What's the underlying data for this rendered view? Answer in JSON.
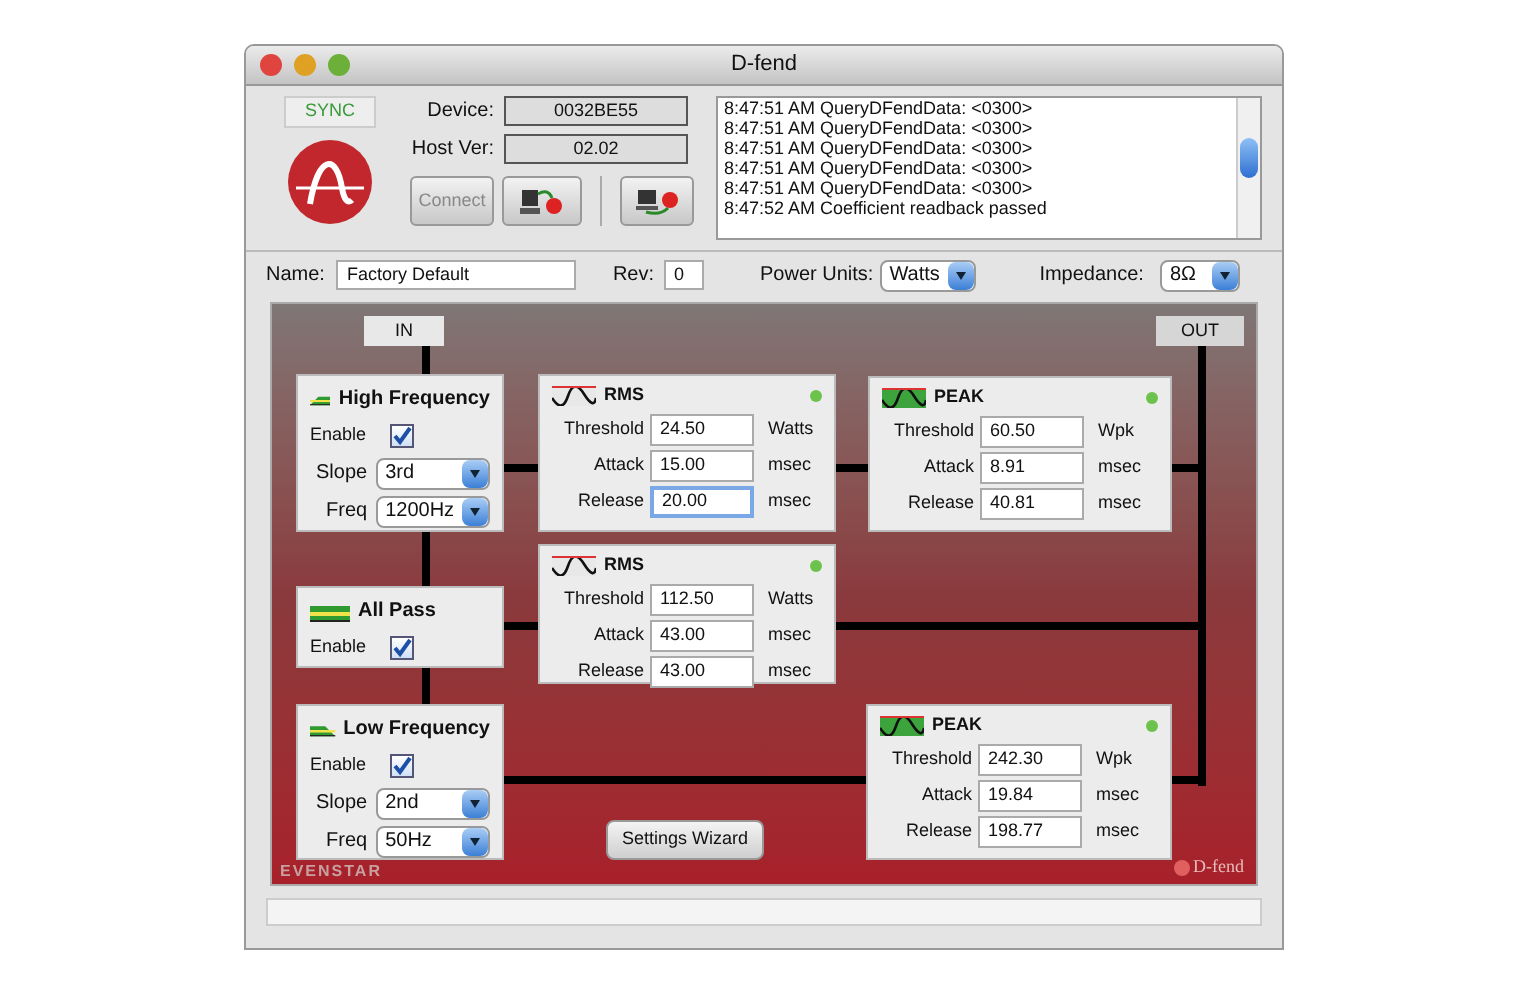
{
  "window": {
    "title": "D-fend"
  },
  "sync": {
    "label": "SYNC",
    "on": true
  },
  "device": {
    "label": "Device:",
    "value": "0032BE55"
  },
  "host_ver": {
    "label": "Host Ver:",
    "value": "02.02"
  },
  "connect_button": {
    "label": "Connect",
    "disabled": true
  },
  "log": {
    "lines": [
      "8:47:51 AM QueryDFendData: <0300>",
      "8:47:51 AM QueryDFendData: <0300>",
      "8:47:51 AM QueryDFendData: <0300>",
      "8:47:51 AM QueryDFendData: <0300>",
      "8:47:51 AM QueryDFendData: <0300>",
      "8:47:52 AM Coefficient readback passed"
    ]
  },
  "settings": {
    "name": {
      "label": "Name:",
      "value": "Factory Default"
    },
    "rev": {
      "label": "Rev:",
      "value": "0"
    },
    "power_units": {
      "label": "Power Units:",
      "value": "Watts"
    },
    "impedance": {
      "label": "Impedance:",
      "value": "8Ω"
    }
  },
  "canvas": {
    "input_label": "IN",
    "output_label": "OUT",
    "filters": [
      {
        "kind": "high",
        "title": "High Frequency",
        "enable_label": "Enable",
        "enabled": true,
        "slope": {
          "label": "Slope",
          "value": "3rd"
        },
        "freq": {
          "label": "Freq",
          "value": "1200Hz"
        }
      },
      {
        "kind": "allpass",
        "title": "All Pass",
        "enable_label": "Enable",
        "enabled": true
      },
      {
        "kind": "low",
        "title": "Low Frequency",
        "enable_label": "Enable",
        "enabled": true,
        "slope": {
          "label": "Slope",
          "value": "2nd"
        },
        "freq": {
          "label": "Freq",
          "value": "50Hz"
        }
      }
    ],
    "limiters": [
      {
        "kind": "rms",
        "title": "RMS",
        "on": true,
        "rows": [
          {
            "label": "Threshold",
            "value": "24.50",
            "unit": "Watts",
            "focused": false
          },
          {
            "label": "Attack",
            "value": "15.00",
            "unit": "msec",
            "focused": false
          },
          {
            "label": "Release",
            "value": "20.00",
            "unit": "msec",
            "focused": true
          }
        ]
      },
      {
        "kind": "peak",
        "title": "PEAK",
        "on": true,
        "rows": [
          {
            "label": "Threshold",
            "value": "60.50",
            "unit": "Wpk",
            "focused": false
          },
          {
            "label": "Attack",
            "value": "8.91",
            "unit": "msec",
            "focused": false
          },
          {
            "label": "Release",
            "value": "40.81",
            "unit": "msec",
            "focused": false
          }
        ]
      },
      {
        "kind": "rms",
        "title": "RMS",
        "on": true,
        "rows": [
          {
            "label": "Threshold",
            "value": "112.50",
            "unit": "Watts",
            "focused": false
          },
          {
            "label": "Attack",
            "value": "43.00",
            "unit": "msec",
            "focused": false
          },
          {
            "label": "Release",
            "value": "43.00",
            "unit": "msec",
            "focused": false
          }
        ]
      },
      {
        "kind": "peak",
        "title": "PEAK",
        "on": true,
        "rows": [
          {
            "label": "Threshold",
            "value": "242.30",
            "unit": "Wpk",
            "focused": false
          },
          {
            "label": "Attack",
            "value": "19.84",
            "unit": "msec",
            "focused": false
          },
          {
            "label": "Release",
            "value": "198.77",
            "unit": "msec",
            "focused": false
          }
        ]
      }
    ],
    "wizard_button": "Settings Wizard",
    "brand_left": "EVENSTAR",
    "brand_right": "D-fend"
  }
}
